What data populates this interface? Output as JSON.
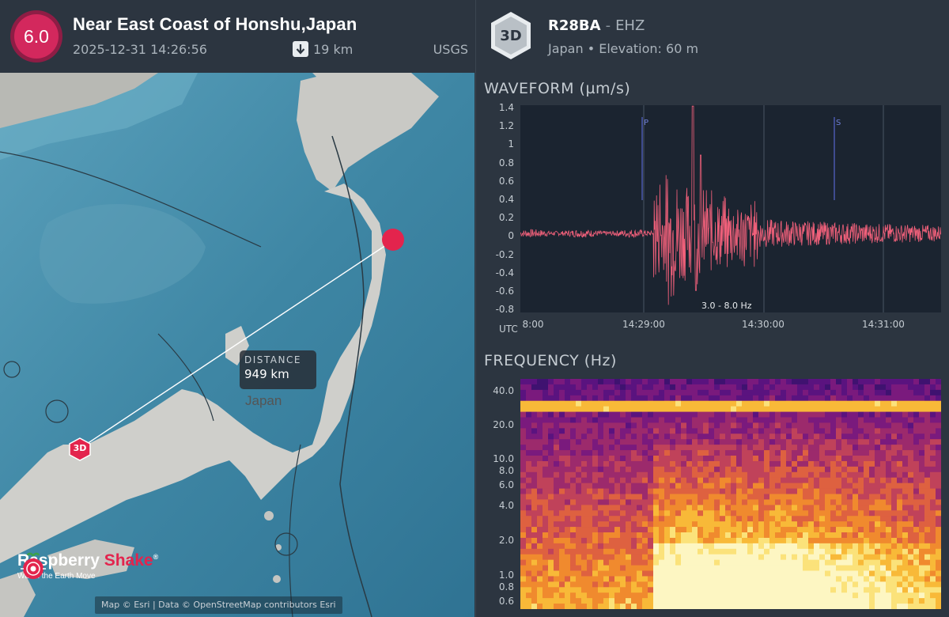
{
  "event": {
    "magnitude": "6.0",
    "title": "Near East Coast of Honshu,Japan",
    "datetime": "2025-12-31 14:26:56",
    "depth": "19 km",
    "source": "USGS"
  },
  "map": {
    "distance_label": "DISTANCE",
    "distance_value": "949 km",
    "country_label": "Japan",
    "station_marker_label": "3D",
    "brand_name_a": "Raspberry ",
    "brand_name_b": "Shake",
    "brand_reg": "®",
    "brand_tagline": "Watch the Earth Move",
    "attribution": "Map © Esri | Data © OpenStreetMap contributors Esri"
  },
  "station": {
    "badge": "3D",
    "code": "R28BA",
    "separator": "-",
    "channel": "EHZ",
    "subtitle": "Japan • Elevation: 60 m"
  },
  "waveform": {
    "title": "WAVEFORM (µm/s)",
    "band": "3.0 - 8.0 Hz",
    "utc_label": "UTC",
    "y_ticks": [
      "1.4",
      "1.2",
      "1",
      "0.8",
      "0.6",
      "0.4",
      "0.2",
      "0",
      "-0.2",
      "-0.4",
      "-0.6",
      "-0.8"
    ],
    "x_ticks": [
      "8:00",
      "14:29:00",
      "14:30:00",
      "14:31:00"
    ],
    "p_label": "P",
    "s_label": "S",
    "color": "#f0607a"
  },
  "frequency": {
    "title": "FREQUENCY (Hz)",
    "y_ticks": [
      "40.0",
      "20.0",
      "10.0",
      "8.0",
      "6.0",
      "4.0",
      "2.0",
      "1.0",
      "0.8",
      "0.6"
    ]
  },
  "colors": {
    "accent": "#e3244d",
    "panel": "#2c3540",
    "plot_bg": "#1b2430"
  }
}
